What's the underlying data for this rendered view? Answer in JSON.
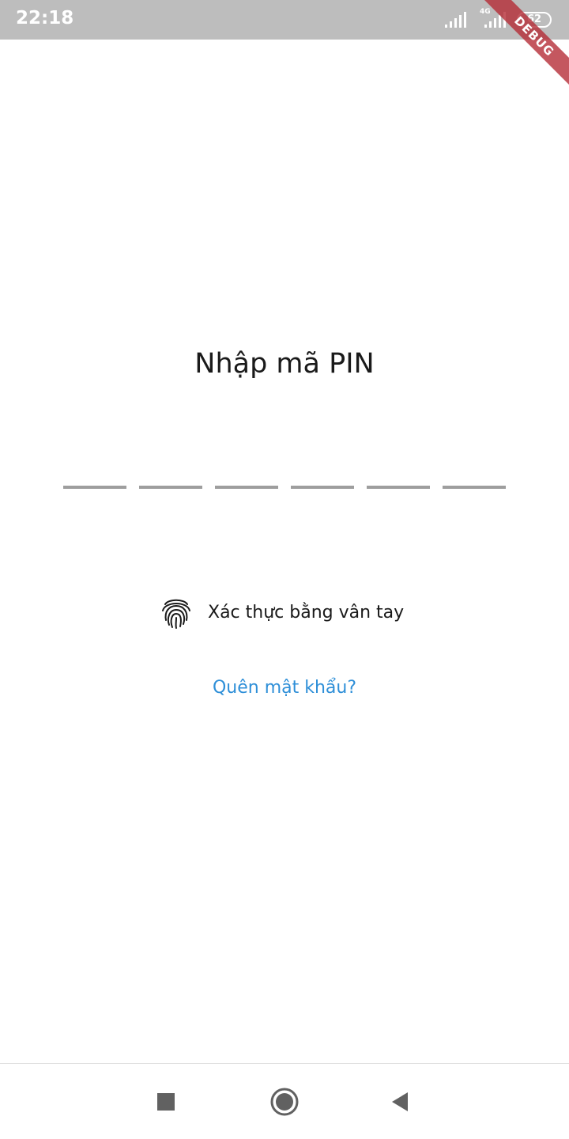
{
  "status_bar": {
    "time": "22:18",
    "network_type": "4G",
    "battery_level": "62"
  },
  "debug_banner": "DEBUG",
  "pin_screen": {
    "title": "Nhập mã PIN",
    "pin_length": 6,
    "fingerprint_label": "Xác thực bằng vân tay",
    "forgot_password": "Quên mật khẩu?"
  },
  "colors": {
    "link": "#2e8fd8",
    "pin_slot": "#9e9e9e",
    "status_bar": "#bdbdbd",
    "debug_banner": "#b42832"
  },
  "icons": {
    "fingerprint": "fingerprint-icon",
    "recents": "square-icon",
    "home": "circle-icon",
    "back": "triangle-back-icon"
  }
}
